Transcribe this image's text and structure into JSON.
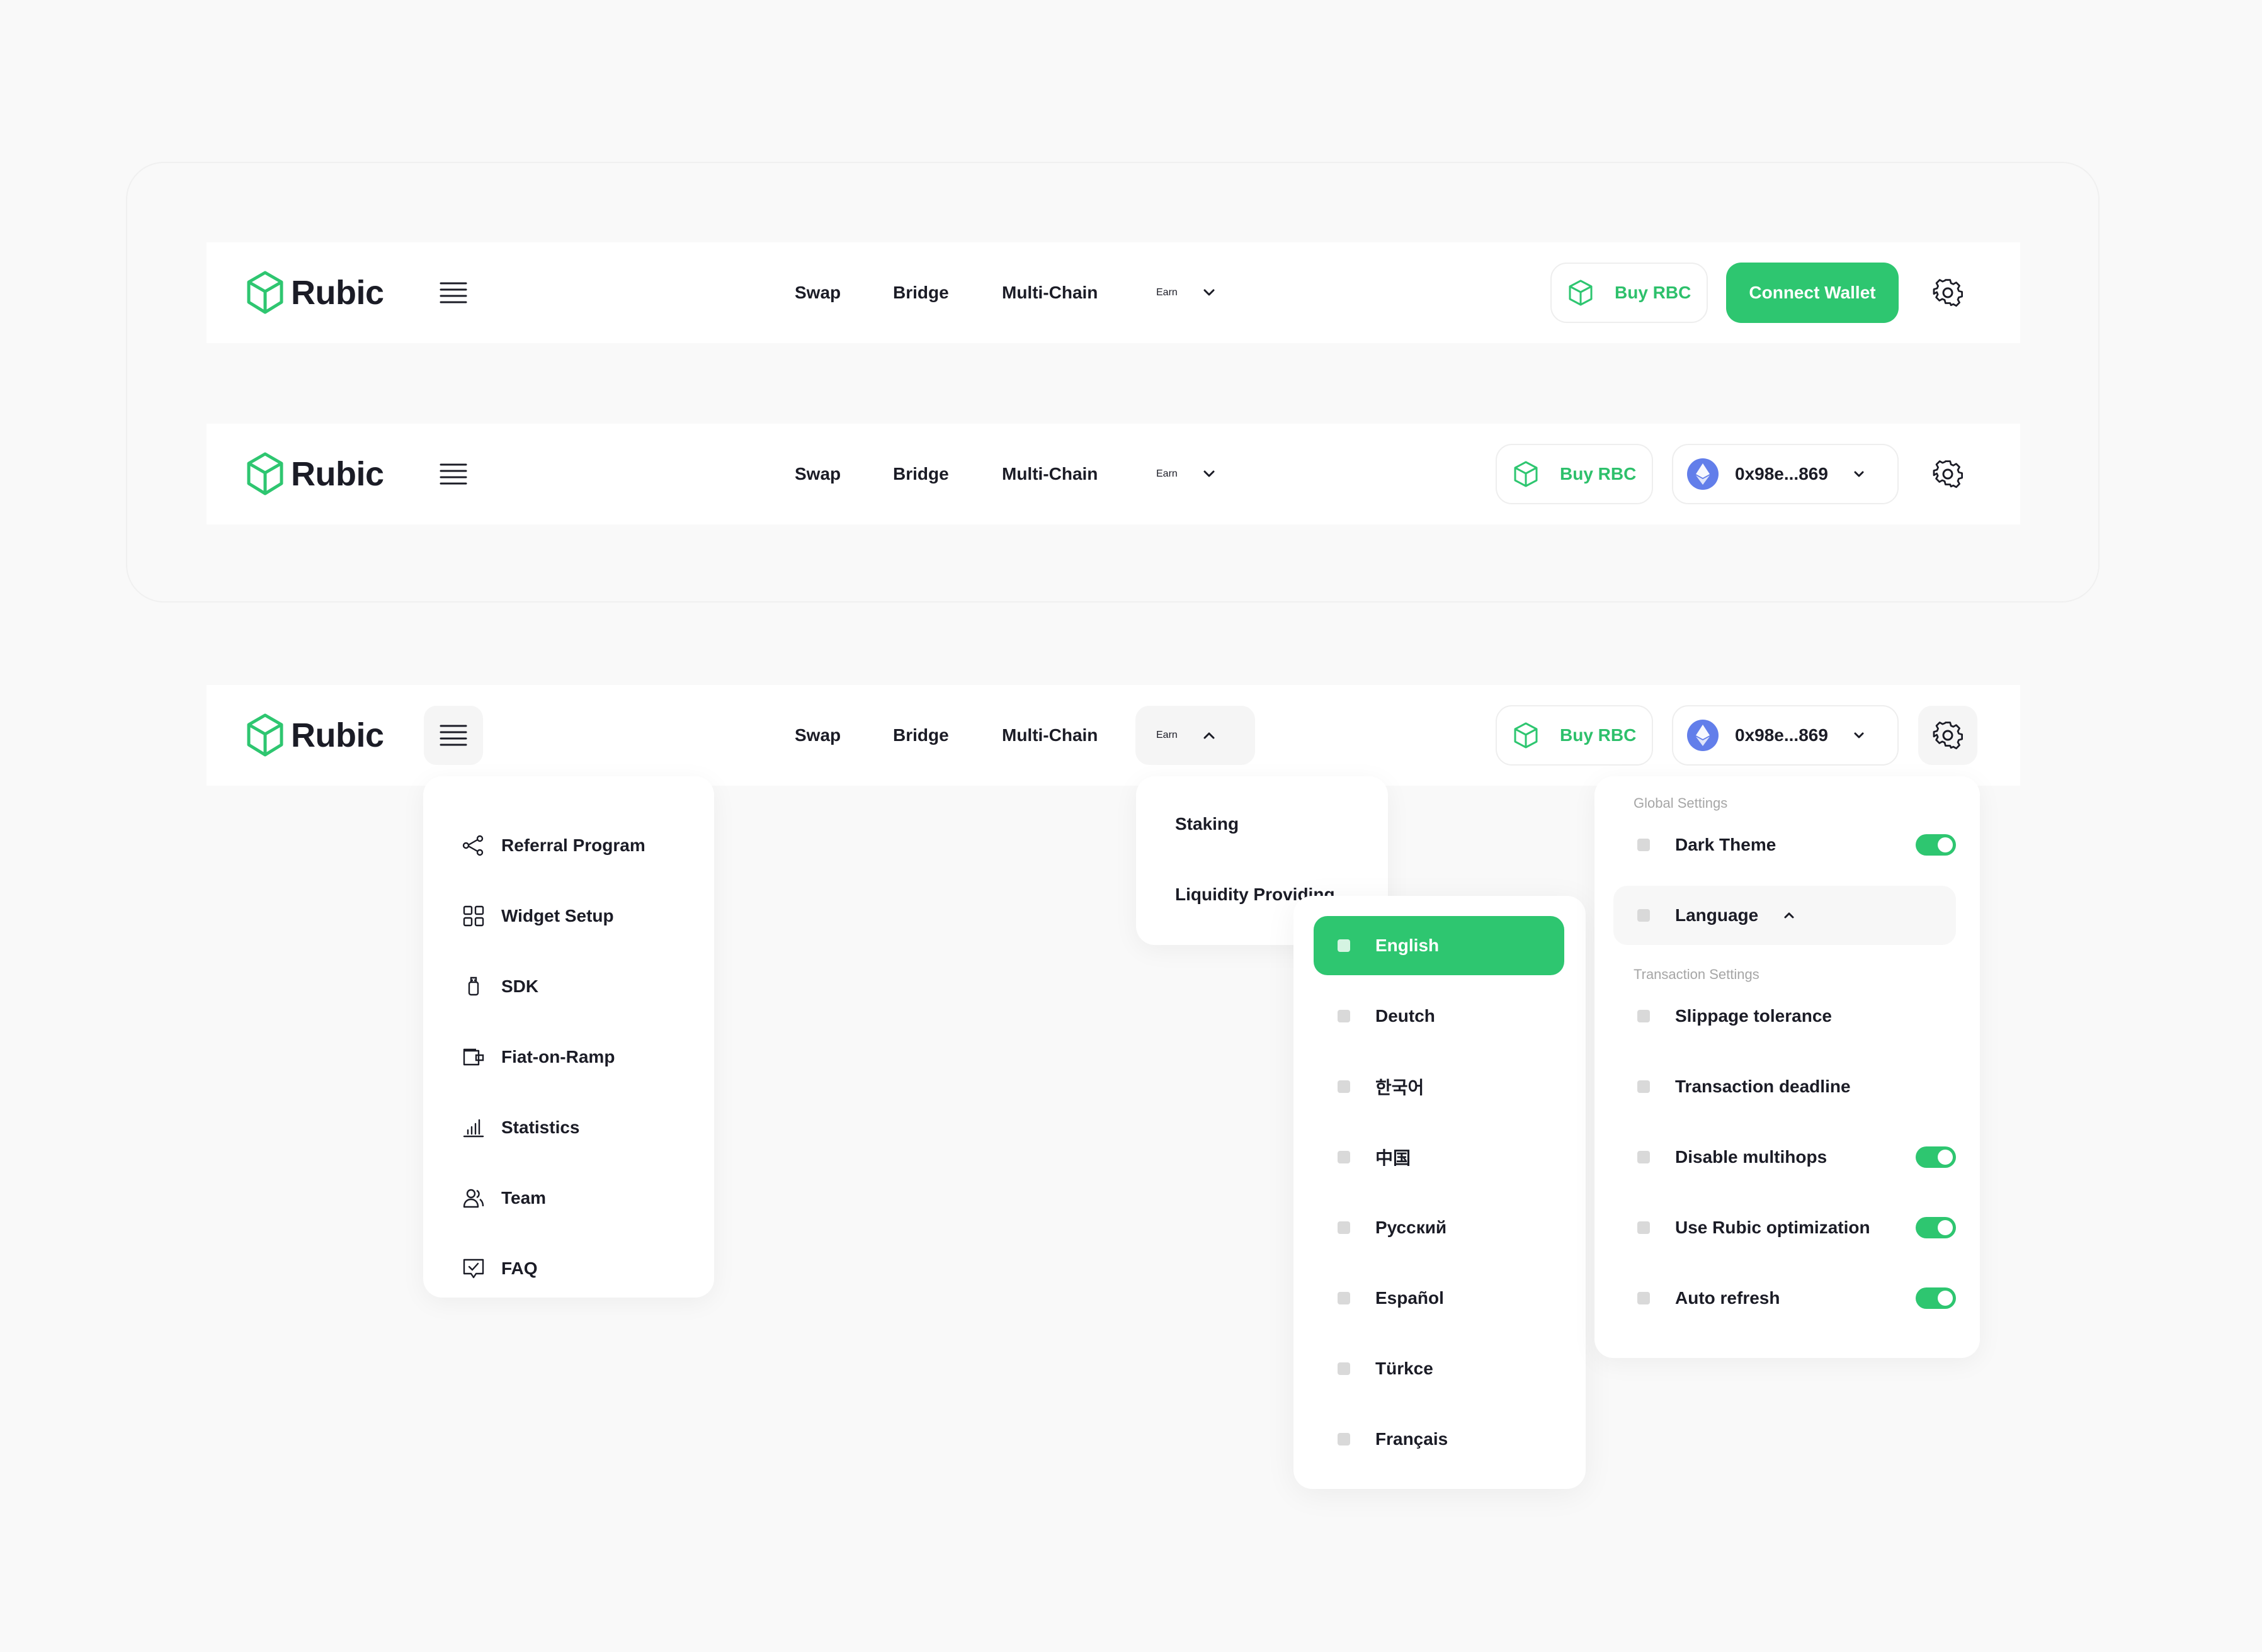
{
  "brand": {
    "name": "Rubic",
    "accent": "#2ec670",
    "text": "#1b1c26"
  },
  "nav": {
    "swap": "Swap",
    "bridge": "Bridge",
    "multichain": "Multi-Chain",
    "earn": "Earn"
  },
  "actions": {
    "buy_rbc": "Buy RBC",
    "connect_wallet": "Connect Wallet",
    "wallet_address": "0x98e...869",
    "wallet_network_icon": "ethereum-icon"
  },
  "burger_menu": {
    "items": [
      {
        "label": "Referral Program",
        "icon": "share-icon"
      },
      {
        "label": "Widget Setup",
        "icon": "grid-icon"
      },
      {
        "label": "SDK",
        "icon": "usb-icon"
      },
      {
        "label": "Fiat-on-Ramp",
        "icon": "wallet-icon"
      },
      {
        "label": "Statistics",
        "icon": "bar-chart-icon"
      },
      {
        "label": "Team",
        "icon": "team-icon"
      },
      {
        "label": "FAQ",
        "icon": "faq-icon"
      }
    ]
  },
  "earn_menu": {
    "items": [
      "Staking",
      "Liquidity Providing"
    ]
  },
  "language_menu": {
    "selected": "English",
    "items": [
      "English",
      "Deutch",
      "한국어",
      "中国",
      "Русский",
      "Español",
      "Türkce",
      "Français"
    ]
  },
  "settings": {
    "global_heading": "Global Settings",
    "transaction_heading": "Transaction Settings",
    "dark_theme": {
      "label": "Dark Theme",
      "enabled": true
    },
    "language": {
      "label": "Language"
    },
    "slippage": {
      "label": "Slippage tolerance"
    },
    "deadline": {
      "label": "Transaction deadline"
    },
    "multihops": {
      "label": "Disable multihops",
      "enabled": true
    },
    "optimization": {
      "label": "Use Rubic optimization",
      "enabled": true
    },
    "auto_refresh": {
      "label": "Auto refresh",
      "enabled": true
    }
  }
}
